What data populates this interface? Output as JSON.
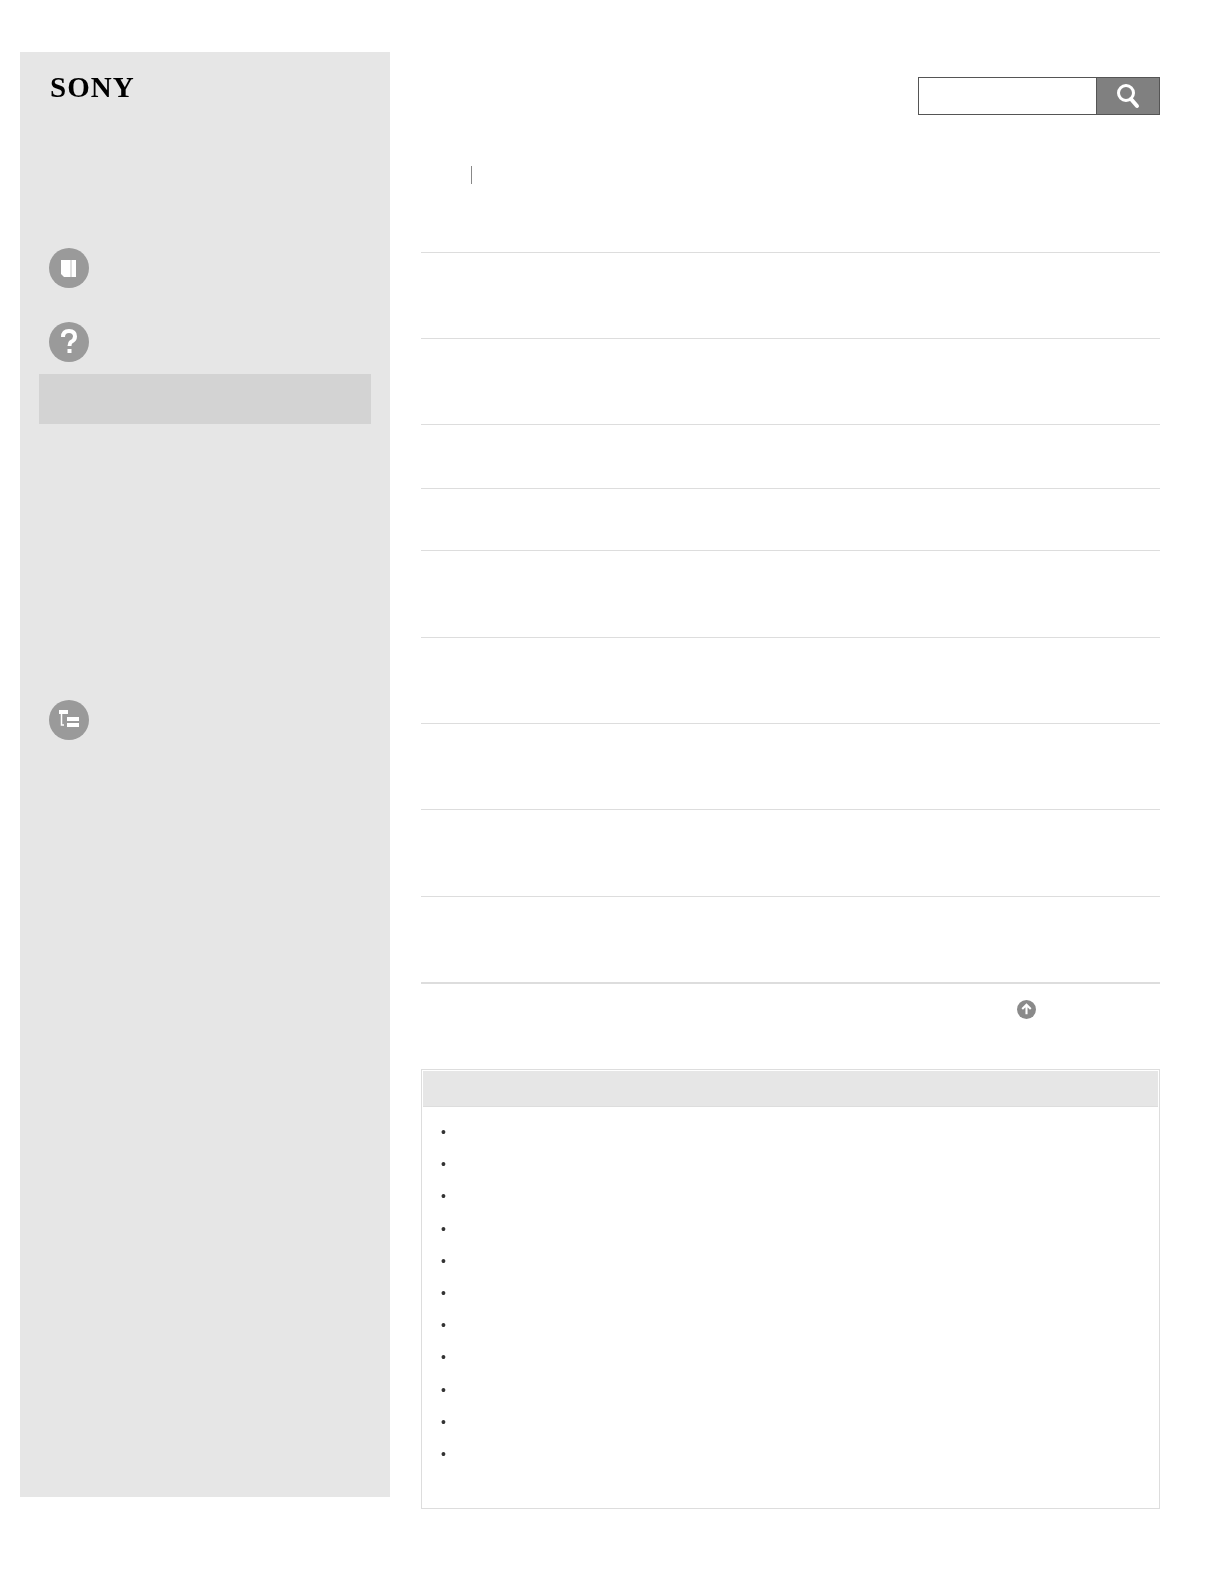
{
  "logo": "SONY",
  "sidebar": {
    "items": [
      {
        "kind": "book"
      },
      {
        "kind": "help"
      },
      {
        "kind": "row",
        "selected": true
      },
      {
        "kind": "tree"
      }
    ]
  },
  "list_items": [
    "•",
    "•",
    "•",
    "•",
    "•",
    "•",
    "•",
    "•",
    "•",
    "•",
    "•"
  ]
}
